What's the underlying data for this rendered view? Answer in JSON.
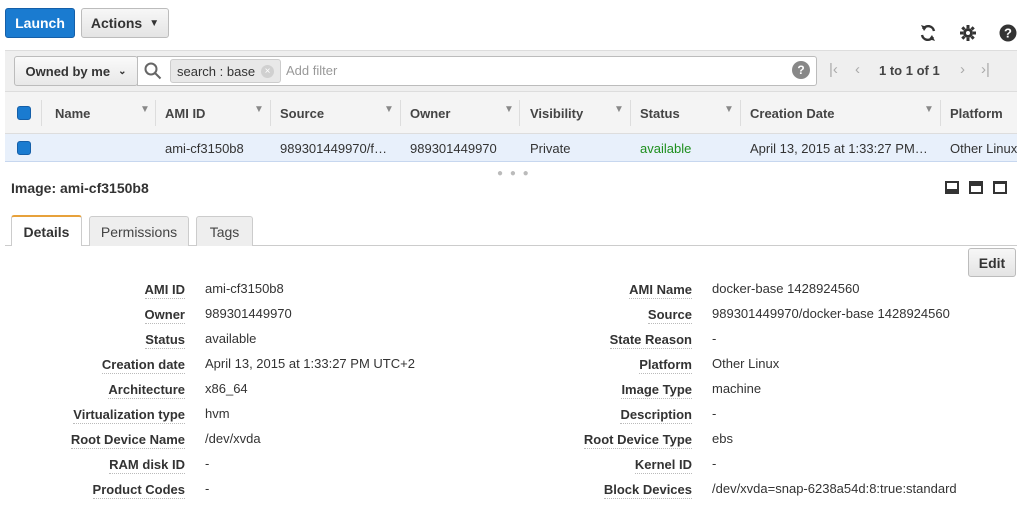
{
  "toolbar": {
    "launch_label": "Launch",
    "actions_label": "Actions"
  },
  "filter": {
    "owned_label": "Owned by me",
    "token_label": "search : base",
    "placeholder": "Add filter",
    "pagination": "1 to 1 of 1"
  },
  "table": {
    "columns": [
      "Name",
      "AMI ID",
      "Source",
      "Owner",
      "Visibility",
      "Status",
      "Creation Date",
      "Platform"
    ],
    "row": {
      "name": "",
      "ami_id": "ami-cf3150b8",
      "source": "989301449970/f…",
      "owner": "989301449970",
      "visibility": "Private",
      "status": "available",
      "creation_date": "April 13, 2015 at 1:33:27 PM…",
      "platform": "Other Linux"
    }
  },
  "detail": {
    "title": "Image: ami-cf3150b8",
    "tabs": [
      "Details",
      "Permissions",
      "Tags"
    ],
    "edit_label": "Edit",
    "left": [
      {
        "label": "AMI ID",
        "value": "ami-cf3150b8"
      },
      {
        "label": "Owner",
        "value": "989301449970"
      },
      {
        "label": "Status",
        "value": "available"
      },
      {
        "label": "Creation date",
        "value": "April 13, 2015 at 1:33:27 PM UTC+2"
      },
      {
        "label": "Architecture",
        "value": "x86_64"
      },
      {
        "label": "Virtualization type",
        "value": "hvm"
      },
      {
        "label": "Root Device Name",
        "value": "/dev/xvda"
      },
      {
        "label": "RAM disk ID",
        "value": "-"
      },
      {
        "label": "Product Codes",
        "value": "-"
      }
    ],
    "right": [
      {
        "label": "AMI Name",
        "value": "docker-base 1428924560"
      },
      {
        "label": "Source",
        "value": "989301449970/docker-base 1428924560"
      },
      {
        "label": "State Reason",
        "value": "-"
      },
      {
        "label": "Platform",
        "value": "Other Linux"
      },
      {
        "label": "Image Type",
        "value": "machine"
      },
      {
        "label": "Description",
        "value": "-"
      },
      {
        "label": "Root Device Type",
        "value": "ebs"
      },
      {
        "label": "Kernel ID",
        "value": "-"
      },
      {
        "label": "Block Devices",
        "value": "/dev/xvda=snap-6238a54d:8:true:standard"
      }
    ]
  },
  "colors": {
    "primary": "#1a7bd0",
    "status_green": "#1e8f1e",
    "tab_accent": "#e7a13b",
    "row_selected": "#e8f0fb"
  }
}
